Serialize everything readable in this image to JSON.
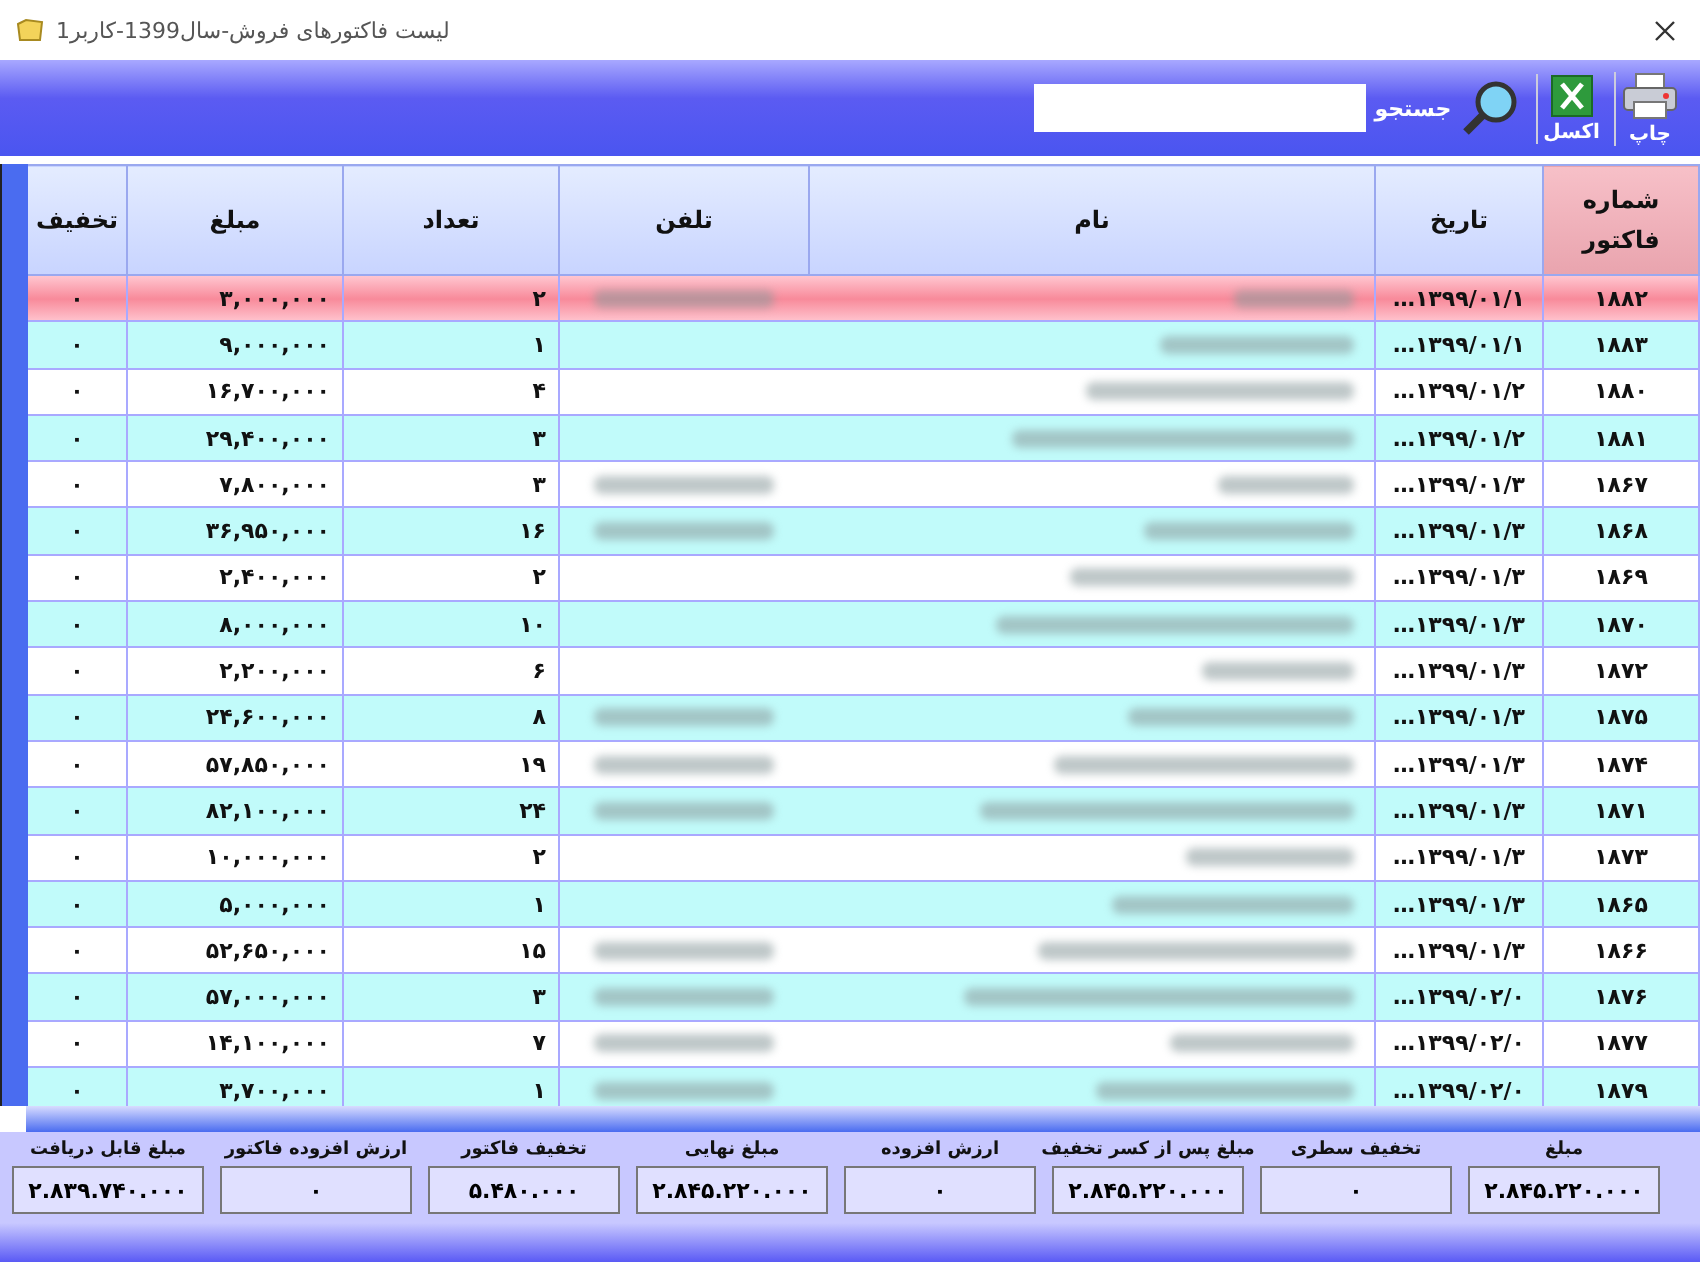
{
  "window": {
    "title": "لیست فاکتورهای فروش-سال1399-کاربر1"
  },
  "toolbar": {
    "buttons": [
      {
        "label": "چاپ",
        "kind": "print"
      },
      {
        "label": "اکسل",
        "kind": "excel"
      }
    ],
    "search": {
      "label": "جستجو"
    }
  },
  "table": {
    "columns": [
      "شماره فاکتور",
      "تاریخ",
      "نام",
      "تلفن",
      "تعداد",
      "مبلغ",
      "تخفیف"
    ],
    "rows": [
      {
        "number": "۱۸۸۲",
        "date": "۱۳۹۹/۰۱/۱…",
        "count": "۲",
        "amount": "۳,۰۰۰,۰۰۰",
        "discount": "۰",
        "phone_blurred": true,
        "selected": true
      },
      {
        "number": "۱۸۸۳",
        "date": "۱۳۹۹/۰۱/۱…",
        "count": "۱",
        "amount": "۹,۰۰۰,۰۰۰",
        "discount": "۰",
        "phone_blurred": false,
        "selected": false
      },
      {
        "number": "۱۸۸۰",
        "date": "۱۳۹۹/۰۱/۲…",
        "count": "۴",
        "amount": "۱۶,۷۰۰,۰۰۰",
        "discount": "۰",
        "phone_blurred": false,
        "selected": false
      },
      {
        "number": "۱۸۸۱",
        "date": "۱۳۹۹/۰۱/۲…",
        "count": "۳",
        "amount": "۲۹,۴۰۰,۰۰۰",
        "discount": "۰",
        "phone_blurred": false,
        "selected": false
      },
      {
        "number": "۱۸۶۷",
        "date": "۱۳۹۹/۰۱/۳…",
        "count": "۳",
        "amount": "۷,۸۰۰,۰۰۰",
        "discount": "۰",
        "phone_blurred": true,
        "selected": false
      },
      {
        "number": "۱۸۶۸",
        "date": "۱۳۹۹/۰۱/۳…",
        "count": "۱۶",
        "amount": "۳۶,۹۵۰,۰۰۰",
        "discount": "۰",
        "phone_blurred": true,
        "selected": false
      },
      {
        "number": "۱۸۶۹",
        "date": "۱۳۹۹/۰۱/۳…",
        "count": "۲",
        "amount": "۲,۴۰۰,۰۰۰",
        "discount": "۰",
        "phone_blurred": false,
        "selected": false
      },
      {
        "number": "۱۸۷۰",
        "date": "۱۳۹۹/۰۱/۳…",
        "count": "۱۰",
        "amount": "۸,۰۰۰,۰۰۰",
        "discount": "۰",
        "phone_blurred": false,
        "selected": false
      },
      {
        "number": "۱۸۷۲",
        "date": "۱۳۹۹/۰۱/۳…",
        "count": "۶",
        "amount": "۲,۲۰۰,۰۰۰",
        "discount": "۰",
        "phone_blurred": false,
        "selected": false
      },
      {
        "number": "۱۸۷۵",
        "date": "۱۳۹۹/۰۱/۳…",
        "count": "۸",
        "amount": "۲۴,۶۰۰,۰۰۰",
        "discount": "۰",
        "phone_blurred": true,
        "selected": false
      },
      {
        "number": "۱۸۷۴",
        "date": "۱۳۹۹/۰۱/۳…",
        "count": "۱۹",
        "amount": "۵۷,۸۵۰,۰۰۰",
        "discount": "۰",
        "phone_blurred": true,
        "selected": false
      },
      {
        "number": "۱۸۷۱",
        "date": "۱۳۹۹/۰۱/۳…",
        "count": "۲۴",
        "amount": "۸۲,۱۰۰,۰۰۰",
        "discount": "۰",
        "phone_blurred": true,
        "selected": false
      },
      {
        "number": "۱۸۷۳",
        "date": "۱۳۹۹/۰۱/۳…",
        "count": "۲",
        "amount": "۱۰,۰۰۰,۰۰۰",
        "discount": "۰",
        "phone_blurred": false,
        "selected": false
      },
      {
        "number": "۱۸۶۵",
        "date": "۱۳۹۹/۰۱/۳…",
        "count": "۱",
        "amount": "۵,۰۰۰,۰۰۰",
        "discount": "۰",
        "phone_blurred": false,
        "selected": false
      },
      {
        "number": "۱۸۶۶",
        "date": "۱۳۹۹/۰۱/۳…",
        "count": "۱۵",
        "amount": "۵۲,۶۵۰,۰۰۰",
        "discount": "۰",
        "phone_blurred": true,
        "selected": false
      },
      {
        "number": "۱۸۷۶",
        "date": "۱۳۹۹/۰۲/۰…",
        "count": "۳",
        "amount": "۵۷,۰۰۰,۰۰۰",
        "discount": "۰",
        "phone_blurred": true,
        "selected": false
      },
      {
        "number": "۱۸۷۷",
        "date": "۱۳۹۹/۰۲/۰…",
        "count": "۷",
        "amount": "۱۴,۱۰۰,۰۰۰",
        "discount": "۰",
        "phone_blurred": true,
        "selected": false
      },
      {
        "number": "۱۸۷۹",
        "date": "۱۳۹۹/۰۲/۰…",
        "count": "۱",
        "amount": "۳,۷۰۰,۰۰۰",
        "discount": "۰",
        "phone_blurred": true,
        "selected": false
      }
    ]
  },
  "totals": [
    {
      "label": "مبلغ",
      "value": "۲.۸۴۵.۲۲۰.۰۰۰"
    },
    {
      "label": "تخفیف سطری",
      "value": "۰"
    },
    {
      "label": "مبلغ پس از کسر تخفیف",
      "value": "۲.۸۴۵.۲۲۰.۰۰۰"
    },
    {
      "label": "ارزش افزوده",
      "value": "۰"
    },
    {
      "label": "مبلغ نهایی",
      "value": "۲.۸۴۵.۲۲۰.۰۰۰"
    },
    {
      "label": "تخفیف فاکتور",
      "value": "۵.۴۸۰.۰۰۰"
    },
    {
      "label": "ارزش افزوده فاکتور",
      "value": "۰"
    },
    {
      "label": "مبلغ قابل دریافت",
      "value": "۲.۸۳۹.۷۴۰.۰۰۰"
    }
  ]
}
